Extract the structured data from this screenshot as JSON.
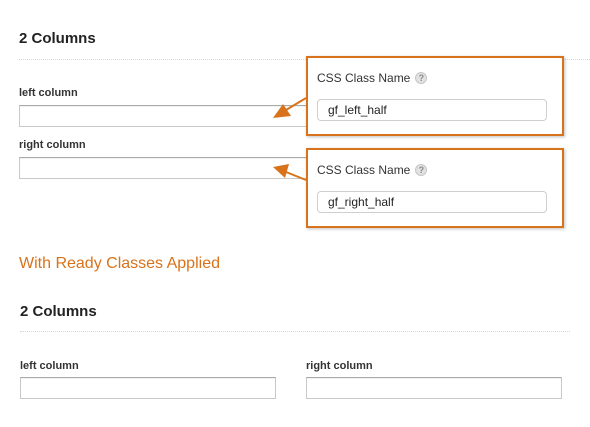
{
  "top_section": {
    "title": "2 Columns",
    "fields": [
      {
        "label": "left column",
        "value": ""
      },
      {
        "label": "right column",
        "value": ""
      }
    ]
  },
  "callouts": [
    {
      "label": "CSS Class Name",
      "help_icon": "question-mark",
      "value": "gf_left_half"
    },
    {
      "label": "CSS Class Name",
      "help_icon": "question-mark",
      "value": "gf_right_half"
    }
  ],
  "ready_heading": "With Ready Classes Applied",
  "bottom_section": {
    "title": "2 Columns",
    "fields": [
      {
        "label": "left column",
        "value": ""
      },
      {
        "label": "right column",
        "value": ""
      }
    ]
  },
  "colors": {
    "accent": "#d8731c",
    "input_border": "#c9c9c9",
    "text": "#222222"
  }
}
